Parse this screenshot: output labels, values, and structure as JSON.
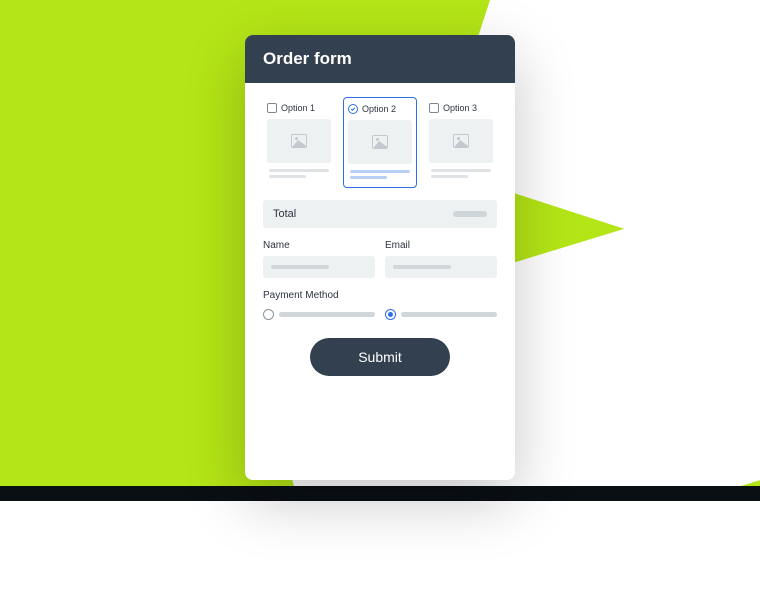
{
  "header": {
    "title": "Order form"
  },
  "options": [
    {
      "label": "Option 1",
      "selected": false
    },
    {
      "label": "Option 2",
      "selected": true
    },
    {
      "label": "Option 3",
      "selected": false
    }
  ],
  "total": {
    "label": "Total"
  },
  "fields": {
    "name": {
      "label": "Name"
    },
    "email": {
      "label": "Email"
    }
  },
  "payment": {
    "label": "Payment Method",
    "selected_index": 1
  },
  "submit": {
    "label": "Submit"
  },
  "colors": {
    "accent_bg": "#b4e516",
    "header_bg": "#32404f",
    "selected_border": "#2d6fe8"
  }
}
